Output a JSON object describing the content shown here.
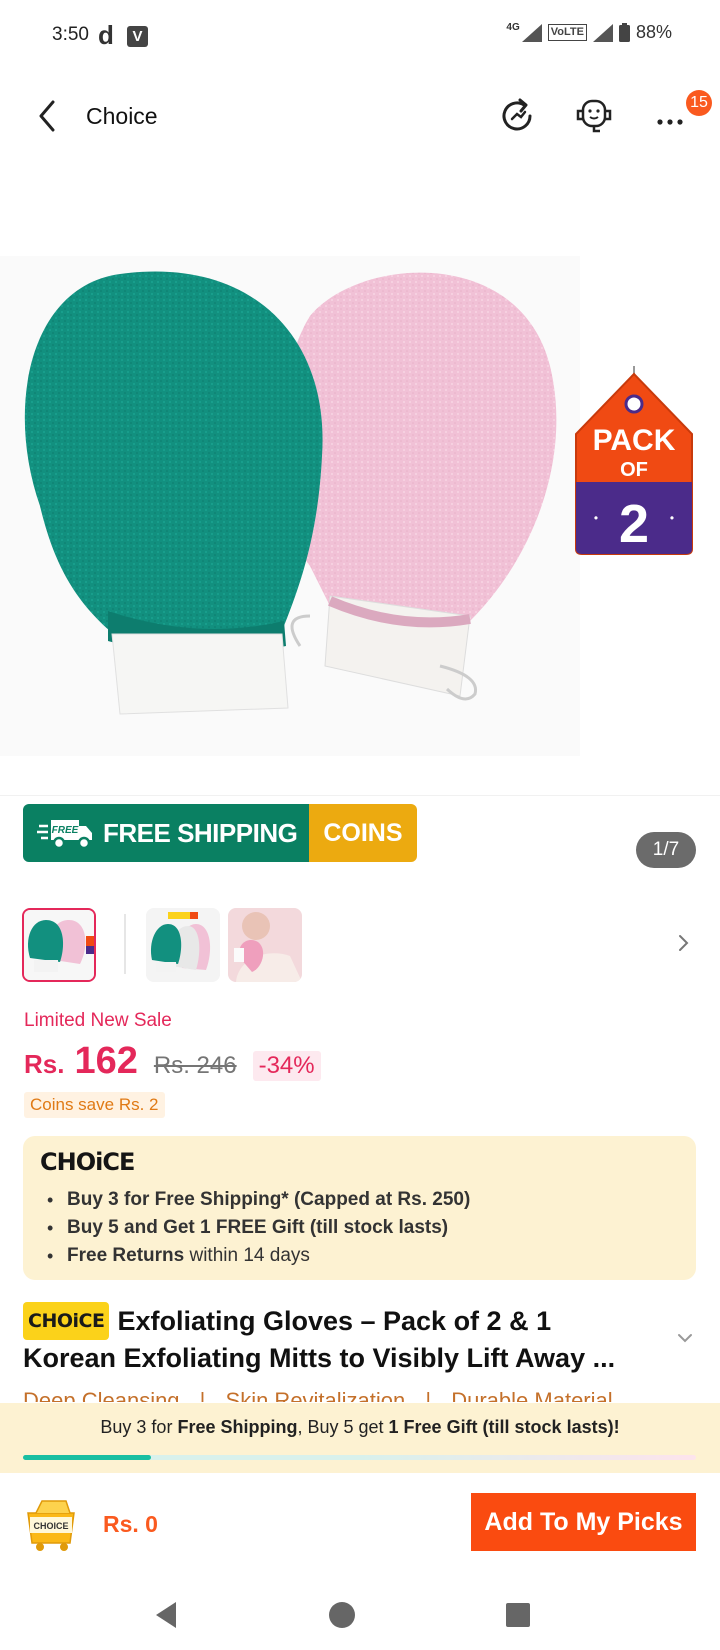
{
  "status_bar": {
    "time": "3:50",
    "notif_d": "d",
    "notif_v": "V",
    "net": "4G",
    "volte": "VoLTE",
    "battery": "88%"
  },
  "header": {
    "title": "Choice",
    "cart_badge": "15",
    "icons": [
      "back-arrow-icon",
      "share-refresh-icon",
      "customer-service-icon",
      "more-icon"
    ]
  },
  "gallery": {
    "pack_tag_line1": "PACK",
    "pack_tag_line2": "OF",
    "pack_tag_number": "2",
    "counter": "1/7",
    "thumb_tag": "Pack of 2"
  },
  "shipping_banner": {
    "free_badge": "FREE",
    "label": "FREE SHIPPING",
    "coins": "COINS"
  },
  "pricing": {
    "sale_label": "Limited New Sale",
    "currency": "Rs.",
    "price": "162",
    "original_price": "Rs. 246",
    "discount": "-34%",
    "coins_save": "Coins save Rs. 2"
  },
  "choice_box": {
    "logo": "CHOiCE",
    "item1": "Buy 3 for  Free Shipping* (Capped at Rs. 250)",
    "item2": "Buy 5 and Get 1 FREE Gift (till stock lasts)",
    "item3_bold": "Free Returns",
    "item3_rest": " within 14 days"
  },
  "title": {
    "tag": "CHOiCE",
    "line1": "Exfoliating Gloves –  Pack of 2 & 1",
    "line2": "Korean Exfoliating Mitts to Visibly Lift Away ...",
    "features": [
      "Deep Cleansing",
      "|",
      "Skin Revitalization",
      "|",
      "Durable Material"
    ]
  },
  "promo": {
    "part1": "Buy 3 for ",
    "bold1": "Free Shipping",
    "part2": ", Buy 5 get ",
    "bold2": "1 Free Gift (till stock lasts)!",
    "progress": 0.19
  },
  "action_bar": {
    "cart_label": "CHOICE",
    "cart_price": "Rs. 0",
    "add_button": "Add To My Picks"
  },
  "colors": {
    "brand_orange": "#fa4b10",
    "sale_red": "#e4285a",
    "ship_green": "#0a8062",
    "coins_yellow": "#ecaa10",
    "choice_bg": "#fdf2d2"
  }
}
